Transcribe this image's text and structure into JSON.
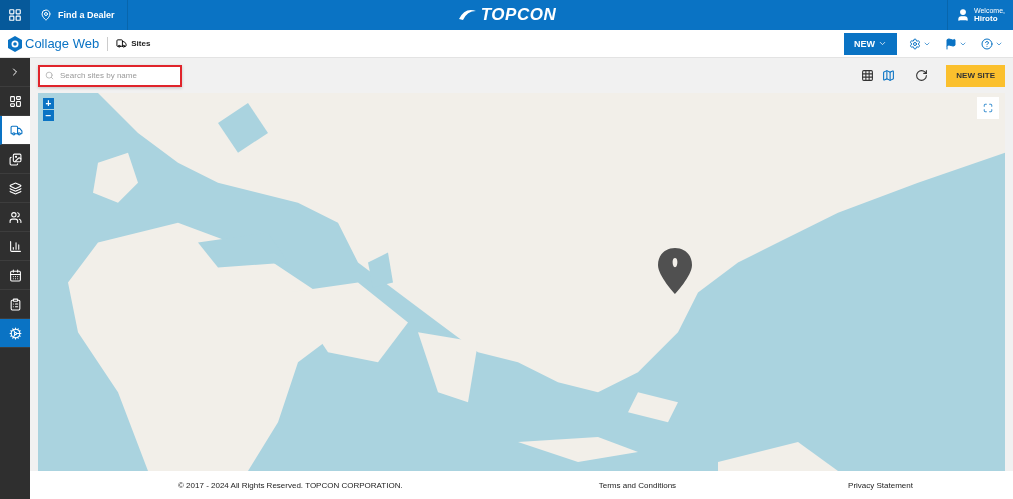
{
  "top_bar": {
    "dealer_link": "Find a Dealer",
    "brand": "TOPCON",
    "welcome": "Welcome,",
    "user": "Hiroto"
  },
  "app_bar": {
    "app_name": "Collage Web",
    "page": "Sites",
    "new_button": "NEW"
  },
  "sidebar": {
    "items": [
      {
        "selected": false,
        "highlighted": false
      },
      {
        "selected": true,
        "highlighted": false
      },
      {
        "selected": false,
        "highlighted": false
      },
      {
        "selected": false,
        "highlighted": false
      },
      {
        "selected": false,
        "highlighted": false
      },
      {
        "selected": false,
        "highlighted": false
      },
      {
        "selected": false,
        "highlighted": false
      },
      {
        "selected": false,
        "highlighted": false
      },
      {
        "selected": false,
        "highlighted": true
      }
    ]
  },
  "toolbar": {
    "search": {
      "placeholder": "Search sites by name"
    },
    "views": [
      {
        "selected": false
      },
      {
        "selected": true
      }
    ],
    "new_site_button": "NEW SITE"
  },
  "map": {
    "kind": "picture",
    "zoom_in": "+",
    "zoom_out": "−"
  },
  "footer": {
    "copyright": "© 2017 - 2024 All Rights Reserved. TOPCON CORPORATION.",
    "terms": "Terms and Conditions",
    "privacy": "Privacy Statement"
  }
}
